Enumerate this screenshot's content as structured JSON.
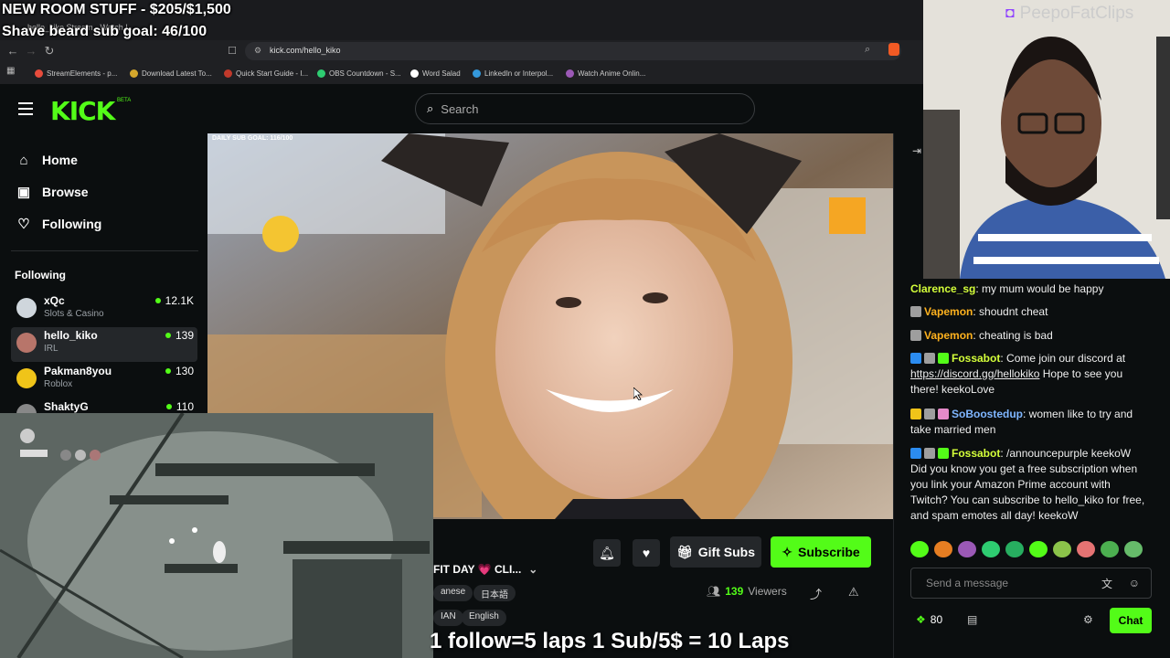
{
  "overlay": {
    "goal1": "NEW ROOM STUFF - $205/$1,500",
    "goal2": "Shave beard sub goal: 46/100",
    "watermark": "PeepoFatClips",
    "laps": "1 follow=5 laps 1 Sub/5$ = 10 Laps"
  },
  "browser": {
    "tab_title": "hello_kiko Stream - Watch L...",
    "url": "kick.com/hello_kiko",
    "bookmarks": [
      {
        "label": "StreamElements - p...",
        "color": "#e74c3c"
      },
      {
        "label": "Download Latest To...",
        "color": "#d4a72c"
      },
      {
        "label": "Quick Start Guide - I...",
        "color": "#c0392b"
      },
      {
        "label": "OBS Countdown - S...",
        "color": "#2ecc71"
      },
      {
        "label": "Word Salad",
        "color": "#ffffff"
      },
      {
        "label": "LinkedIn or Interpol...",
        "color": "#3498db"
      },
      {
        "label": "Watch Anime Onlin...",
        "color": "#9b59b6"
      }
    ]
  },
  "kick": {
    "logo": "KICK",
    "logo_badge": "BETA",
    "search_placeholder": "Search"
  },
  "sidebar": {
    "nav": [
      {
        "label": "Home",
        "icon": "home-icon"
      },
      {
        "label": "Browse",
        "icon": "browse-icon"
      },
      {
        "label": "Following",
        "icon": "heart-icon"
      }
    ],
    "following_title": "Following",
    "channels": [
      {
        "name": "xQc",
        "category": "Slots & Casino",
        "viewers": "12.1K",
        "color": "#cfd6dc"
      },
      {
        "name": "hello_kiko",
        "category": "IRL",
        "viewers": "139",
        "color": "#b8756a"
      },
      {
        "name": "Pakman8you",
        "category": "Roblox",
        "viewers": "130",
        "color": "#f0c419"
      },
      {
        "name": "ShaktyG",
        "category": "",
        "viewers": "110",
        "color": "#888"
      }
    ]
  },
  "video": {
    "sub_goal": "DAILY SUB GOAL: 116/100"
  },
  "stream": {
    "gift_label": "Gift Subs",
    "subscribe_label": "Subscribe",
    "title": "FIT DAY 💗 CLI...",
    "tags_row1": [
      "anese",
      "日本語"
    ],
    "tags_row2": [
      "IAN",
      "English"
    ],
    "viewer_count": "139",
    "viewer_label": "Viewers"
  },
  "chat": {
    "messages": [
      {
        "user": "Clarence_sg",
        "color": "#d4ff3a",
        "text": " my mum would be happy",
        "badges": []
      },
      {
        "user": "Vapemon",
        "color": "#ffb21e",
        "text": " shoudnt cheat",
        "badges": [
          "#9e9e9e"
        ]
      },
      {
        "user": "Vapemon",
        "color": "#ffb21e",
        "text": " cheating is bad",
        "badges": [
          "#9e9e9e"
        ]
      },
      {
        "user": "Fossabot",
        "color": "#d4ff3a",
        "text": " Come join our discord at ",
        "link": "https://discord.gg/hellokiko",
        "tail": " Hope to see you there! keekoLove",
        "badges": [
          "#2b8cf0",
          "#9e9e9e",
          "#53fc18"
        ]
      },
      {
        "user": "SoBoostedup",
        "color": "#7fb6ff",
        "text": " women like to try and take married men",
        "badges": [
          "#f0c419",
          "#9e9e9e",
          "#e58ac9"
        ]
      },
      {
        "user": "Fossabot",
        "color": "#d4ff3a",
        "text": " /announcepurple keekoW Did you know you get a free subscription when you link your Amazon Prime account with Twitch? You can subscribe to hello_kiko for free, and spam emotes all day! keekoW",
        "badges": [
          "#2b8cf0",
          "#9e9e9e",
          "#53fc18"
        ]
      }
    ],
    "placeholder": "Send a message",
    "points": "80",
    "send_label": "Chat"
  }
}
